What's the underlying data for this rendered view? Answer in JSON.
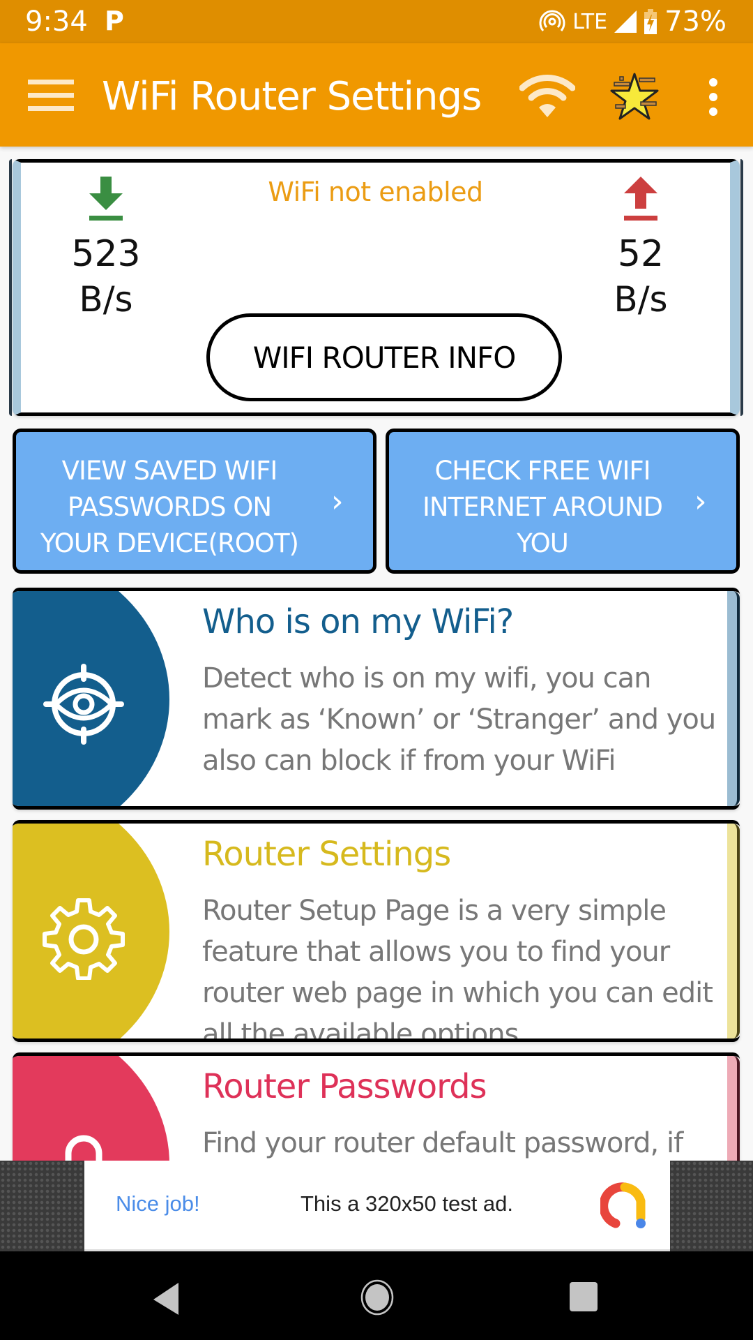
{
  "status_bar": {
    "time": "9:34",
    "notification_icon": "P",
    "network": "LTE",
    "battery": "73%",
    "icons": [
      "hotspot-icon",
      "signal-icon",
      "battery-charging-icon"
    ]
  },
  "app_bar": {
    "title": "WiFi Router Settings",
    "icons": [
      "menu-icon",
      "wifi-icon",
      "star-premium-icon",
      "more-vert-icon"
    ]
  },
  "speed_card": {
    "status": "WiFi not enabled",
    "download": {
      "value": "523",
      "unit": "B/s",
      "icon": "download-arrow-icon"
    },
    "upload": {
      "value": "52",
      "unit": "B/s",
      "icon": "upload-arrow-icon"
    },
    "info_button_label": "WIFI ROUTER INFO"
  },
  "quick_buttons": [
    {
      "label_lines": [
        "VIEW SAVED WIFI",
        "PASSWORDS ON",
        "YOUR DEVICE(ROOT)"
      ],
      "chevron": "›"
    },
    {
      "label_lines": [
        "CHECK FREE WIFI",
        "INTERNET AROUND",
        "YOU"
      ],
      "chevron": "›"
    }
  ],
  "features": [
    {
      "title": "Who is on my WiFi?",
      "description": "Detect who is on my wifi, you can mark as ‘Known’ or ‘Stranger’ and you also can block if from your WiFi",
      "icon": "eye-target-icon",
      "color": "#135e8d"
    },
    {
      "title": "Router Settings",
      "description": "Router Setup Page is a very simple feature that allows you to find your router web page in which you can edit all the available options",
      "icon": "gear-icon",
      "color": "#dcbf21"
    },
    {
      "title": "Router Passwords",
      "description": "Find your router default password, if",
      "icon": "lock-icon",
      "color": "#e33a5c"
    }
  ],
  "ad": {
    "headline": "Nice job!",
    "text": "This a 320x50 test ad."
  },
  "nav_bar": {
    "buttons": [
      "back",
      "home",
      "recents"
    ]
  }
}
